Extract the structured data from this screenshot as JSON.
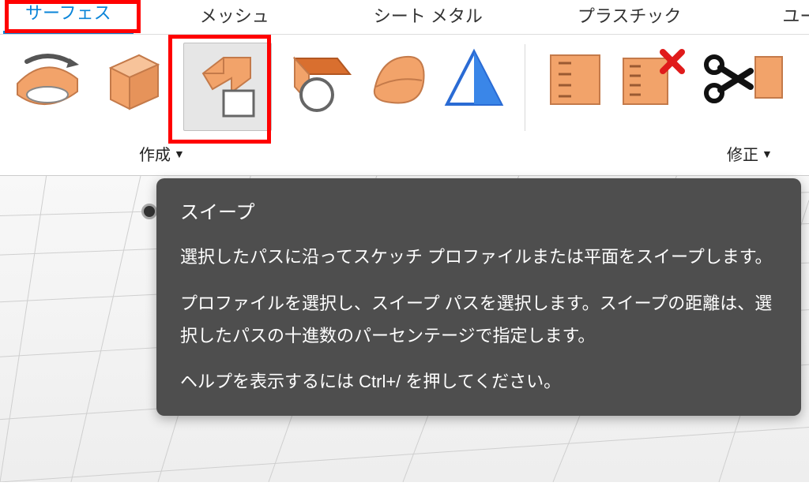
{
  "tabs": {
    "surface": "サーフェス",
    "mesh": "メッシュ",
    "sheetmetal": "シート メタル",
    "plastic": "プラスチック",
    "utility": "ユーティリ"
  },
  "groups": {
    "create_label": "作成",
    "modify_label": "修正"
  },
  "tooltip": {
    "title": "スイープ",
    "p1": "選択したパスに沿ってスケッチ プロファイルまたは平面をスイープします。",
    "p2": "プロファイルを選択し、スイープ パスを選択します。スイープの距離は、選択したパスの十進数のパーセンテージで指定します。",
    "p3": "ヘルプを表示するには Ctrl+/ を押してください。"
  },
  "icons": {
    "revolve": "revolve-icon",
    "box": "box-icon",
    "sweep": "sweep-icon",
    "loft": "loft-icon",
    "patch": "patch-icon",
    "plane": "plane-icon",
    "presspull1": "presspull-icon",
    "presspull2": "presspull-delete-icon",
    "trim": "trim-icon"
  },
  "colors": {
    "accent": "#0a84d8",
    "highlight": "#ff0000",
    "tool_fill": "#f2a36a",
    "tool_stroke": "#c47a4a"
  }
}
